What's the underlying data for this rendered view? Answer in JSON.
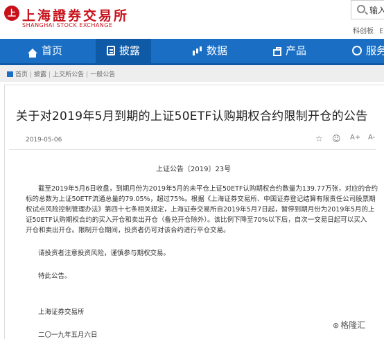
{
  "header": {
    "logo_mark": "上",
    "logo_cn": "上海證券交易所",
    "logo_en": "SHANGHAI STOCK EXCHANGE",
    "search_text": "输入",
    "links": [
      "科创板",
      "En"
    ]
  },
  "nav": {
    "items": [
      {
        "label": "首页",
        "icon": "home-icon"
      },
      {
        "label": "披露",
        "icon": "disclosure-icon",
        "active": true
      },
      {
        "label": "数据",
        "icon": "data-icon"
      },
      {
        "label": "产品",
        "icon": "product-icon"
      },
      {
        "label": "服务",
        "icon": "service-icon"
      }
    ],
    "color": "#1a6fc4"
  },
  "breadcrumb": [
    "首页",
    "披露",
    "上交所公告",
    "一般公告"
  ],
  "article": {
    "title": "关于对2019年5月到期的上证50ETF认购期权合约限制开仓的公告",
    "date": "2019-05-06",
    "tools": [
      "☆",
      "☺",
      "A+",
      "A-"
    ],
    "doc_no": "上证公告〔2019〕23号",
    "para1": [
      "截至2019年5月6日收盘，到期月份为2019年5月的未平仓上证50ETF认购期权合约数量为139.77万张，对应的合约",
      "标的总数为上证50ETF流通总量的79.05%，超过75%。根据《上海证券交易所、中国证券登记结算有限责任公司股票期",
      "权试点风险控制管理办法》第四十七条相关规定，上海证券交易所自2019年5月7日起，暂停到期月份为2019年5月的上",
      "证50ETF认购期权合约的买入开仓和卖出开仓（备兑开仓除外）。该比例下降至70%以下后，自次一交易日起可以买入",
      "开仓和卖出开仓。限制开仓期间，投资者仍可对该合约进行平仓交易。"
    ],
    "para2": "请投资者注意投资风险，谨慎参与期权交易。",
    "para3": "特此公告。",
    "signature": "上海证券交易所",
    "sign_date": "二〇一九年五月六日"
  },
  "watermark": {
    "icon": "⊛",
    "text": "格隆汇"
  }
}
